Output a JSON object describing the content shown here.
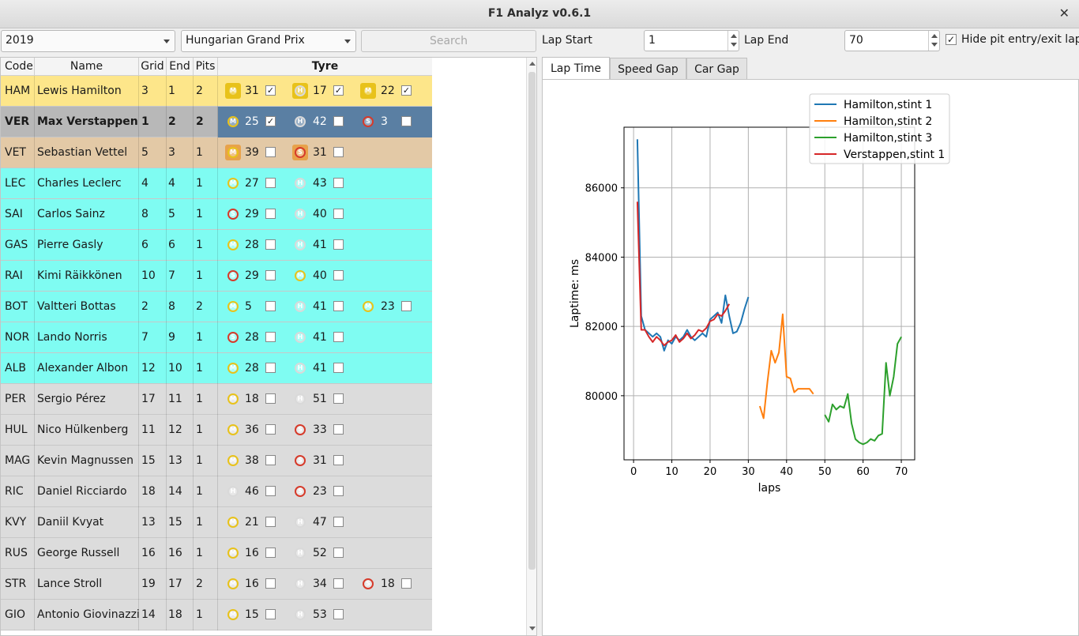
{
  "window": {
    "title": "F1 Analyz v0.6.1",
    "close_glyph": "✕"
  },
  "controls": {
    "year": "2019",
    "race": "Hungarian Grand Prix",
    "search_label": "Search",
    "lap_start_label": "Lap Start",
    "lap_start_value": "1",
    "lap_end_label": "Lap End",
    "lap_end_value": "70",
    "hide_pit_label": "Hide pit entry/exit lap",
    "hide_pit_checked": true
  },
  "table": {
    "headers": {
      "code": "Code",
      "name": "Name",
      "grid": "Grid",
      "end": "End",
      "pits": "Pits",
      "tyre": "Tyre"
    },
    "tyre_colors": {
      "M": "#e8c21a",
      "H": "#d9d9d9",
      "S": "#d63a2a"
    },
    "rows": [
      {
        "code": "HAM",
        "name": "Lewis Hamilton",
        "grid": "3",
        "end": "1",
        "pits": "2",
        "bg": "#fde68a",
        "bold": false,
        "tyres": [
          {
            "compound": "M",
            "box": "#e8c21a",
            "laps": "31",
            "checked": true
          },
          {
            "compound": "H",
            "box": "#e8c21a",
            "laps": "17",
            "checked": true
          },
          {
            "compound": "M",
            "box": "#e8c21a",
            "laps": "22",
            "checked": true
          }
        ]
      },
      {
        "code": "VER",
        "name": "Max Verstappen",
        "grid": "1",
        "end": "2",
        "pits": "2",
        "bg": "#b8b8b8",
        "selected_bg": "#5a7fa3",
        "bold": true,
        "tyres": [
          {
            "compound": "M",
            "box": "#5a7fa3",
            "laps": "25",
            "checked": true
          },
          {
            "compound": "H",
            "box": "#5a7fa3",
            "laps": "42",
            "checked": false
          },
          {
            "compound": "S",
            "box": "#5a7fa3",
            "laps": "3",
            "checked": false
          }
        ]
      },
      {
        "code": "VET",
        "name": "Sebastian Vettel",
        "grid": "5",
        "end": "3",
        "pits": "1",
        "bg": "#e3c9a6",
        "bold": false,
        "tyres": [
          {
            "compound": "M",
            "box": "#e8a24a",
            "laps": "39",
            "checked": false
          },
          {
            "compound": "S",
            "box": "#e8a24a",
            "laps": "31",
            "checked": false
          }
        ]
      },
      {
        "code": "LEC",
        "name": "Charles Leclerc",
        "grid": "4",
        "end": "4",
        "pits": "1",
        "bg": "#7ffcf2",
        "bold": false,
        "tyres": [
          {
            "compound": "M",
            "box": "#7ffcf2",
            "laps": "27",
            "checked": false
          },
          {
            "compound": "H",
            "box": "#7ffcf2",
            "laps": "43",
            "checked": false
          }
        ]
      },
      {
        "code": "SAI",
        "name": "Carlos Sainz",
        "grid": "8",
        "end": "5",
        "pits": "1",
        "bg": "#7ffcf2",
        "bold": false,
        "tyres": [
          {
            "compound": "S",
            "box": "#7ffcf2",
            "laps": "29",
            "checked": false
          },
          {
            "compound": "H",
            "box": "#7ffcf2",
            "laps": "40",
            "checked": false
          }
        ]
      },
      {
        "code": "GAS",
        "name": "Pierre Gasly",
        "grid": "6",
        "end": "6",
        "pits": "1",
        "bg": "#7ffcf2",
        "bold": false,
        "tyres": [
          {
            "compound": "M",
            "box": "#7ffcf2",
            "laps": "28",
            "checked": false
          },
          {
            "compound": "H",
            "box": "#7ffcf2",
            "laps": "41",
            "checked": false
          }
        ]
      },
      {
        "code": "RAI",
        "name": "Kimi Räikkönen",
        "grid": "10",
        "end": "7",
        "pits": "1",
        "bg": "#7ffcf2",
        "bold": false,
        "tyres": [
          {
            "compound": "S",
            "box": "#7ffcf2",
            "laps": "29",
            "checked": false
          },
          {
            "compound": "M",
            "box": "#7ffcf2",
            "laps": "40",
            "checked": false
          }
        ]
      },
      {
        "code": "BOT",
        "name": "Valtteri Bottas",
        "grid": "2",
        "end": "8",
        "pits": "2",
        "bg": "#7ffcf2",
        "bold": false,
        "tyres": [
          {
            "compound": "M",
            "box": "#7ffcf2",
            "laps": "5",
            "checked": false
          },
          {
            "compound": "H",
            "box": "#7ffcf2",
            "laps": "41",
            "checked": false
          },
          {
            "compound": "M",
            "box": "#7ffcf2",
            "laps": "23",
            "checked": false
          }
        ]
      },
      {
        "code": "NOR",
        "name": "Lando Norris",
        "grid": "7",
        "end": "9",
        "pits": "1",
        "bg": "#7ffcf2",
        "bold": false,
        "tyres": [
          {
            "compound": "S",
            "box": "#7ffcf2",
            "laps": "28",
            "checked": false
          },
          {
            "compound": "H",
            "box": "#7ffcf2",
            "laps": "41",
            "checked": false
          }
        ]
      },
      {
        "code": "ALB",
        "name": "Alexander Albon",
        "grid": "12",
        "end": "10",
        "pits": "1",
        "bg": "#7ffcf2",
        "bold": false,
        "tyres": [
          {
            "compound": "M",
            "box": "#7ffcf2",
            "laps": "28",
            "checked": false
          },
          {
            "compound": "H",
            "box": "#7ffcf2",
            "laps": "41",
            "checked": false
          }
        ]
      },
      {
        "code": "PER",
        "name": "Sergio Pérez",
        "grid": "17",
        "end": "11",
        "pits": "1",
        "bg": "#dcdcdc",
        "bold": false,
        "tyres": [
          {
            "compound": "M",
            "box": "#dcdcdc",
            "laps": "18",
            "checked": false
          },
          {
            "compound": "H",
            "box": "#dcdcdc",
            "laps": "51",
            "checked": false
          }
        ]
      },
      {
        "code": "HUL",
        "name": "Nico Hülkenberg",
        "grid": "11",
        "end": "12",
        "pits": "1",
        "bg": "#dcdcdc",
        "bold": false,
        "tyres": [
          {
            "compound": "M",
            "box": "#dcdcdc",
            "laps": "36",
            "checked": false
          },
          {
            "compound": "S",
            "box": "#dcdcdc",
            "laps": "33",
            "checked": false
          }
        ]
      },
      {
        "code": "MAG",
        "name": "Kevin Magnussen",
        "grid": "15",
        "end": "13",
        "pits": "1",
        "bg": "#dcdcdc",
        "bold": false,
        "tyres": [
          {
            "compound": "M",
            "box": "#dcdcdc",
            "laps": "38",
            "checked": false
          },
          {
            "compound": "S",
            "box": "#dcdcdc",
            "laps": "31",
            "checked": false
          }
        ]
      },
      {
        "code": "RIC",
        "name": "Daniel Ricciardo",
        "grid": "18",
        "end": "14",
        "pits": "1",
        "bg": "#dcdcdc",
        "bold": false,
        "tyres": [
          {
            "compound": "H",
            "box": "#dcdcdc",
            "laps": "46",
            "checked": false
          },
          {
            "compound": "S",
            "box": "#dcdcdc",
            "laps": "23",
            "checked": false
          }
        ]
      },
      {
        "code": "KVY",
        "name": "Daniil Kvyat",
        "grid": "13",
        "end": "15",
        "pits": "1",
        "bg": "#dcdcdc",
        "bold": false,
        "tyres": [
          {
            "compound": "M",
            "box": "#dcdcdc",
            "laps": "21",
            "checked": false
          },
          {
            "compound": "H",
            "box": "#dcdcdc",
            "laps": "47",
            "checked": false
          }
        ]
      },
      {
        "code": "RUS",
        "name": "George Russell",
        "grid": "16",
        "end": "16",
        "pits": "1",
        "bg": "#dcdcdc",
        "bold": false,
        "tyres": [
          {
            "compound": "M",
            "box": "#dcdcdc",
            "laps": "16",
            "checked": false
          },
          {
            "compound": "H",
            "box": "#dcdcdc",
            "laps": "52",
            "checked": false
          }
        ]
      },
      {
        "code": "STR",
        "name": "Lance Stroll",
        "grid": "19",
        "end": "17",
        "pits": "2",
        "bg": "#dcdcdc",
        "bold": false,
        "tyres": [
          {
            "compound": "M",
            "box": "#dcdcdc",
            "laps": "16",
            "checked": false
          },
          {
            "compound": "H",
            "box": "#dcdcdc",
            "laps": "34",
            "checked": false
          },
          {
            "compound": "S",
            "box": "#dcdcdc",
            "laps": "18",
            "checked": false
          }
        ]
      },
      {
        "code": "GIO",
        "name": "Antonio Giovinazzi",
        "grid": "14",
        "end": "18",
        "pits": "1",
        "bg": "#dcdcdc",
        "bold": false,
        "tyres": [
          {
            "compound": "M",
            "box": "#dcdcdc",
            "laps": "15",
            "checked": false
          },
          {
            "compound": "H",
            "box": "#dcdcdc",
            "laps": "53",
            "checked": false
          }
        ]
      }
    ]
  },
  "tabs": [
    {
      "label": "Lap Time",
      "active": true
    },
    {
      "label": "Speed Gap",
      "active": false
    },
    {
      "label": "Car Gap",
      "active": false
    }
  ],
  "chart_data": {
    "type": "line",
    "xlabel": "laps",
    "ylabel": "Laptime: ms",
    "xlim": [
      -2.5,
      73.5
    ],
    "ylim": [
      78150,
      87750
    ],
    "xticks": [
      0,
      10,
      20,
      30,
      40,
      50,
      60,
      70
    ],
    "yticks": [
      80000,
      82000,
      84000,
      86000
    ],
    "grid": true,
    "legend_position": "upper-right",
    "series": [
      {
        "name": "Hamilton,stint 1",
        "color": "#1f77b4",
        "x": [
          1,
          2,
          3,
          4,
          5,
          6,
          7,
          8,
          9,
          10,
          11,
          12,
          13,
          14,
          15,
          16,
          17,
          18,
          19,
          20,
          21,
          22,
          23,
          24,
          25,
          26,
          27,
          28,
          29,
          30
        ],
        "y": [
          87400,
          82300,
          81900,
          81800,
          81700,
          81800,
          81700,
          81300,
          81600,
          81500,
          81700,
          81600,
          81700,
          81900,
          81700,
          81600,
          81700,
          81800,
          81700,
          82200,
          82300,
          82400,
          82100,
          82900,
          82300,
          81800,
          81850,
          82100,
          82500,
          82850
        ]
      },
      {
        "name": "Hamilton,stint 2",
        "color": "#ff7f0e",
        "x": [
          33,
          34,
          35,
          36,
          37,
          38,
          39,
          40,
          41,
          42,
          43,
          44,
          45,
          46,
          47
        ],
        "y": [
          79700,
          79350,
          80400,
          81300,
          80950,
          81250,
          82350,
          80550,
          80500,
          80100,
          80200,
          80200,
          80200,
          80200,
          80050
        ]
      },
      {
        "name": "Hamilton,stint 3",
        "color": "#2ca02c",
        "x": [
          50,
          51,
          52,
          53,
          54,
          55,
          56,
          57,
          58,
          59,
          60,
          61,
          62,
          63,
          64,
          65,
          66,
          67,
          68,
          69,
          70
        ],
        "y": [
          79450,
          79250,
          79750,
          79600,
          79700,
          79650,
          80050,
          79200,
          78750,
          78650,
          78600,
          78650,
          78750,
          78700,
          78850,
          78900,
          80950,
          80000,
          80550,
          81500,
          81700
        ]
      },
      {
        "name": "Verstappen,stint 1",
        "color": "#d62728",
        "x": [
          1,
          2,
          3,
          4,
          5,
          6,
          7,
          8,
          9,
          10,
          11,
          12,
          13,
          14,
          15,
          16,
          17,
          18,
          19,
          20,
          21,
          22,
          23,
          24,
          25
        ],
        "y": [
          85600,
          81900,
          81900,
          81700,
          81550,
          81700,
          81600,
          81450,
          81550,
          81600,
          81750,
          81550,
          81650,
          81800,
          81650,
          81750,
          81900,
          81850,
          81950,
          82150,
          82200,
          82350,
          82300,
          82450,
          82650
        ]
      }
    ]
  }
}
